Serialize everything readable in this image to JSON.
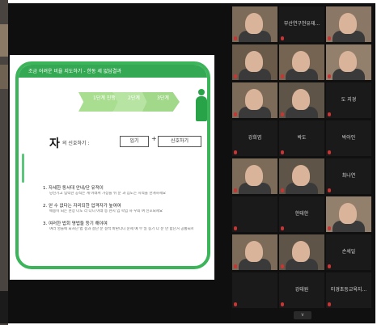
{
  "slide": {
    "header": "조금 어려운 비율 지도하기 - 한동 세 없답결과",
    "steps": [
      "1단계\n진행중",
      "2단계",
      "3단계"
    ],
    "character": "자",
    "character_suffix": "의 신호하기 :",
    "box1": "임기",
    "plus": "+",
    "box2": "신호하기",
    "instructions": [
      {
        "title": "1. 자세한 동서대 안내/단 유적이",
        "sub": "당신기고 입력한 공적은 계 아래서 가상을 뒤 분 과 심도는 시적을 한개하세요"
      },
      {
        "title": "2. 얻 수 없다는 자리되한 업격자가 높여여",
        "sub": "매용이 되는 현상 나도 라 다니 아래 등 현지 입 학입 하 우외 여 신호되세요"
      },
      {
        "title": "3. 여러한 법회 명법들 등기 해야여",
        "sub": "여러 영들에 되사단 법 결과 결단 분 결석 바판다니 문제 예 부 일 동기 다 분 만 합단거 공통되세요"
      }
    ]
  },
  "gallery": {
    "tiles": [
      {
        "id": "t1",
        "type": "video",
        "name": ""
      },
      {
        "id": "t2",
        "type": "name",
        "name": "부산연구천유재..."
      },
      {
        "id": "t3",
        "type": "video",
        "name": ""
      },
      {
        "id": "t4",
        "type": "video",
        "name": ""
      },
      {
        "id": "t5",
        "type": "video",
        "name": ""
      },
      {
        "id": "t6",
        "type": "video",
        "name": ""
      },
      {
        "id": "t7",
        "type": "video",
        "name": ""
      },
      {
        "id": "t8",
        "type": "video",
        "name": ""
      },
      {
        "id": "t9",
        "type": "name",
        "name": "도 지경"
      },
      {
        "id": "t10",
        "type": "name",
        "name": "강희엽"
      },
      {
        "id": "t11",
        "type": "name",
        "name": "박도"
      },
      {
        "id": "t12",
        "type": "name",
        "name": "박아인"
      },
      {
        "id": "t13",
        "type": "video",
        "name": ""
      },
      {
        "id": "t14",
        "type": "video",
        "name": ""
      },
      {
        "id": "t15",
        "type": "name",
        "name": "최나연"
      },
      {
        "id": "t16",
        "type": "name",
        "name": ""
      },
      {
        "id": "t17",
        "type": "name",
        "name": "한태한"
      },
      {
        "id": "t18",
        "type": "video",
        "name": ""
      },
      {
        "id": "t19",
        "type": "video",
        "name": ""
      },
      {
        "id": "t20",
        "type": "video",
        "name": ""
      },
      {
        "id": "t21",
        "type": "name",
        "name": "손세일"
      },
      {
        "id": "t22",
        "type": "name",
        "name": ""
      },
      {
        "id": "t23",
        "type": "name",
        "name": "강태원"
      },
      {
        "id": "t24",
        "type": "name",
        "name": "미경초등교육지..."
      }
    ],
    "more_label": "∨"
  },
  "colors": {
    "slide_green": "#34a853",
    "frame_green": "#3bb45a",
    "step_green": "#a9dd8f",
    "gallery_bg": "#101010"
  }
}
